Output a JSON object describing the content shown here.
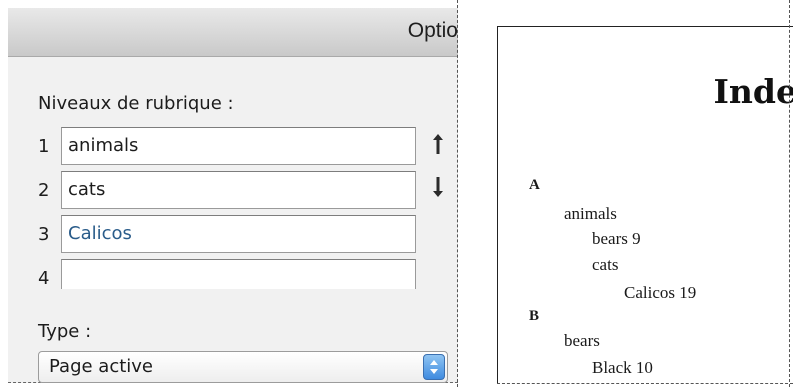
{
  "dialog": {
    "title": "Optio",
    "levels_label": "Niveaux de rubrique :",
    "levels": [
      {
        "num": "1",
        "value": "animals"
      },
      {
        "num": "2",
        "value": "cats"
      },
      {
        "num": "3",
        "value": "Calicos"
      },
      {
        "num": "4",
        "value": ""
      }
    ],
    "arrows": {
      "up_icon": "arrow-up-icon",
      "down_icon": "arrow-down-icon"
    },
    "type_label": "Type :",
    "type_value": "Page active"
  },
  "index_page": {
    "heading": "Inde",
    "entries": [
      {
        "text": "A",
        "kind": "letter"
      },
      {
        "text": "animals",
        "kind": "level1"
      },
      {
        "text": "bears  9",
        "kind": "level2"
      },
      {
        "text": "cats",
        "kind": "level2"
      },
      {
        "text": "Calicos  19",
        "kind": "level3"
      },
      {
        "text": "B",
        "kind": "letter"
      },
      {
        "text": "bears",
        "kind": "level1"
      },
      {
        "text": "Black  10",
        "kind": "level2"
      }
    ]
  }
}
